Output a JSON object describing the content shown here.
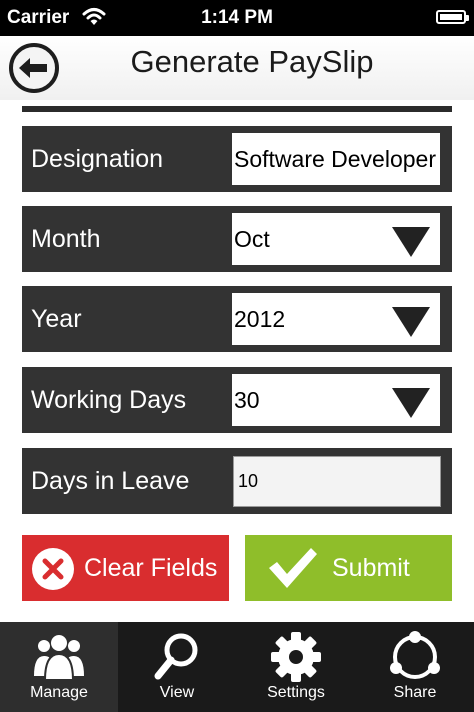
{
  "status_bar": {
    "carrier": "Carrier",
    "time": "1:14 PM"
  },
  "header": {
    "title": "Generate PaySlip",
    "back_icon": "back-arrow-icon"
  },
  "form": {
    "designation": {
      "label": "Designation",
      "value": "Software Developer"
    },
    "month": {
      "label": "Month",
      "value": "Oct"
    },
    "year": {
      "label": "Year",
      "value": "2012"
    },
    "working_days": {
      "label": "Working Days",
      "value": "30"
    },
    "days_in_leave": {
      "label": "Days in Leave",
      "value": "10"
    }
  },
  "buttons": {
    "clear": {
      "label": "Clear Fields",
      "color": "#d92d2f"
    },
    "submit": {
      "label": "Submit",
      "color": "#8fbe2a"
    }
  },
  "tabs": [
    {
      "label": "Manage",
      "icon": "users-icon",
      "active": true
    },
    {
      "label": "View",
      "icon": "magnifier-icon",
      "active": false
    },
    {
      "label": "Settings",
      "icon": "gear-icon",
      "active": false
    },
    {
      "label": "Share",
      "icon": "share-icon",
      "active": false
    }
  ],
  "colors": {
    "row_bg": "#333333",
    "tabbar_bg": "#1a1a1a"
  }
}
